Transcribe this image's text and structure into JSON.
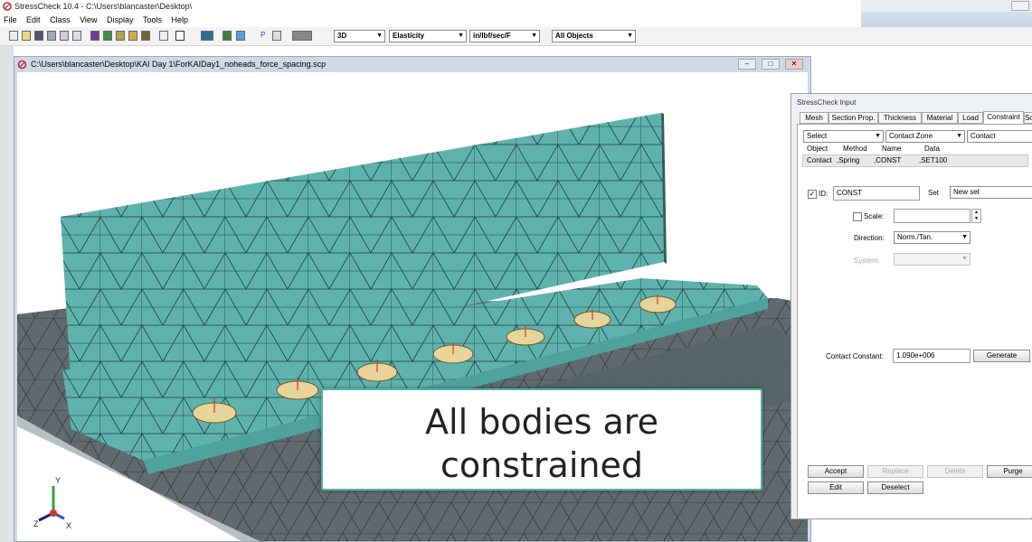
{
  "app": {
    "title": "StressCheck 10.4 - C:\\Users\\blancaster\\Desktop\\"
  },
  "menu": [
    "File",
    "Edit",
    "Class",
    "View",
    "Display",
    "Tools",
    "Help"
  ],
  "toolbar": {
    "view_mode": "3D",
    "analysis_type": "Elasticity",
    "units": "in/lbf/sec/F",
    "object_filter": "All Objects"
  },
  "document": {
    "title": "C:\\Users\\blancaster\\Desktop\\KAI Day 1\\ForKAIDay1_noheads_force_spacing.scp"
  },
  "viewport": {
    "axis_x": "X",
    "axis_y": "Y",
    "axis_z": "Z",
    "mesh_color": "#5fb3ad",
    "base_color": "#5f6b6f",
    "fastener_color": "#e6d49a"
  },
  "input_panel": {
    "title": "StressCheck Input",
    "tabs": [
      "Mesh",
      "Section Prop.",
      "Thickness",
      "Material",
      "Load",
      "Constraint",
      "So"
    ],
    "active_tab": "Constraint",
    "select_combo": "Select",
    "type_combo": "Contact Zone",
    "extra_combo": "Contact",
    "list_headers": [
      "Object",
      "Method",
      "Name",
      "Data"
    ],
    "list_row": [
      "Contact",
      ",Spring",
      ",CONST",
      ",SET100"
    ],
    "id_label": "ID:",
    "id_checked": true,
    "id_value": "CONST",
    "set_label": "Set",
    "set_value": "New set",
    "scale_label": "Scale:",
    "scale_value": "",
    "direction_label": "Direction:",
    "direction_value": "Norm./Tan.",
    "system_label": "System:",
    "system_value": "",
    "contact_constant_label": "Contact Constant:",
    "contact_constant_value": "1.090e+006",
    "generate_label": "Generate",
    "buttons": {
      "accept": "Accept",
      "replace": "Replace",
      "delete": "Delete",
      "purge": "Purge",
      "edit": "Edit",
      "deselect": "Deselect"
    }
  },
  "caption": {
    "line1": "All bodies are",
    "line2": "constrained"
  }
}
